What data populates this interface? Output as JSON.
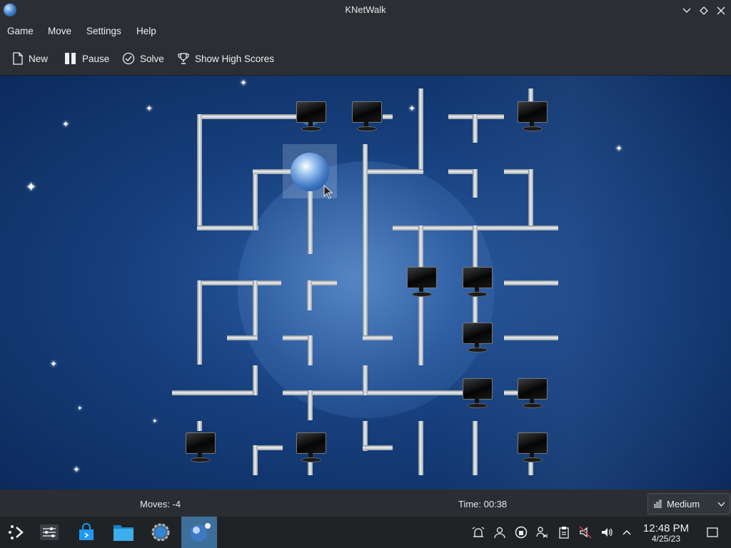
{
  "window": {
    "title": "KNetWalk",
    "app_icon": "knetwalk-globe-icon"
  },
  "menu": {
    "items": [
      "Game",
      "Move",
      "Settings",
      "Help"
    ]
  },
  "toolbar": {
    "new_label": "New",
    "pause_label": "Pause",
    "solve_label": "Solve",
    "high_scores_label": "Show High Scores"
  },
  "status": {
    "moves": "Moves: -4",
    "time": "Time: 00:38",
    "difficulty": "Medium"
  },
  "taskbar": {
    "clock_time": "12:48 PM",
    "clock_date": "4/25/23",
    "apps": [
      "app-launcher-icon",
      "task-manager-icon",
      "discover-store-icon",
      "dolphin-files-icon",
      "system-settings-icon",
      "knetwalk-icon"
    ],
    "tray": [
      "alarm-icon",
      "user-icon",
      "vault-icon",
      "kde-connect-icon",
      "clipboard-icon",
      "audio-muted-icon",
      "volume-icon",
      "expand-tray-icon"
    ]
  },
  "colors": {
    "accent": "#3d6f99",
    "board_bg": "#17407e"
  }
}
